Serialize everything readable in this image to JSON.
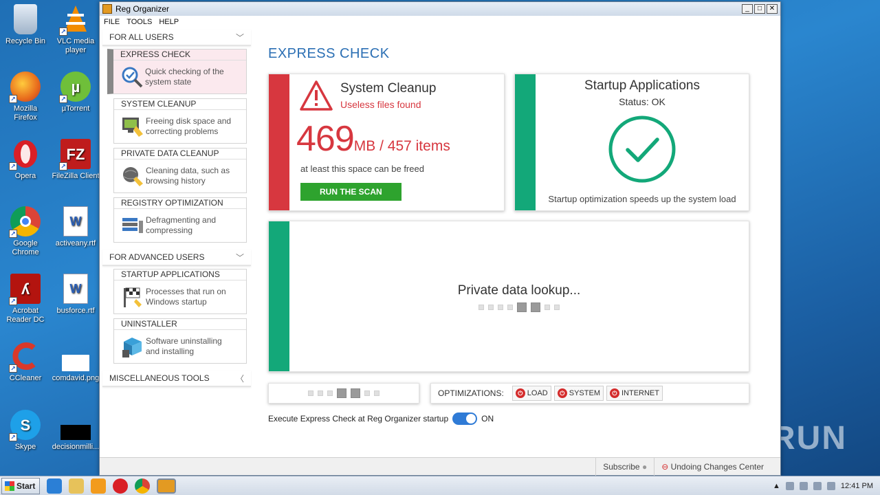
{
  "desktop": {
    "icons": [
      {
        "label": "Recycle Bin",
        "icon": "recycle-bin-icon",
        "color": "#c9d7e6"
      },
      {
        "label": "VLC media player",
        "icon": "vlc-icon",
        "color": "#f28c00"
      },
      {
        "label": "Mozilla Firefox",
        "icon": "firefox-icon",
        "color": "#e86b1c"
      },
      {
        "label": "µTorrent",
        "icon": "utorrent-icon",
        "color": "#6fbf3a"
      },
      {
        "label": "Opera",
        "icon": "opera-icon",
        "color": "#d91f26"
      },
      {
        "label": "FileZilla Client",
        "icon": "filezilla-icon",
        "color": "#bf1c1c"
      },
      {
        "label": "Google Chrome",
        "icon": "chrome-icon",
        "color": "#3f8bd7"
      },
      {
        "label": "activeany.rtf",
        "icon": "word-doc-icon",
        "color": "#ffffff"
      },
      {
        "label": "Acrobat Reader DC",
        "icon": "acrobat-icon",
        "color": "#b3140f"
      },
      {
        "label": "busforce.rtf",
        "icon": "word-doc-icon",
        "color": "#ffffff"
      },
      {
        "label": "CCleaner",
        "icon": "ccleaner-icon",
        "color": "#d9382a"
      },
      {
        "label": "comdavid.png",
        "icon": "image-file-icon",
        "color": "#ffffff"
      },
      {
        "label": "Skype",
        "icon": "skype-icon",
        "color": "#1ea0e8"
      },
      {
        "label": "decisionmilli...",
        "icon": "image-file-icon",
        "color": "#000000"
      }
    ],
    "watermark": "ANY RUN"
  },
  "window": {
    "title": "Reg Organizer",
    "menu": [
      "FILE",
      "TOOLS",
      "HELP"
    ],
    "controls": {
      "minimize": "_",
      "maximize": "□",
      "close": "✕"
    }
  },
  "sidebar": {
    "for_all_users": "FOR ALL USERS",
    "items_all": [
      {
        "title": "EXPRESS CHECK",
        "desc1": "Quick checking of the",
        "desc2": "system state",
        "icon": "magnifier-check-icon",
        "active": true
      },
      {
        "title": "SYSTEM CLEANUP",
        "desc1": "Freeing disk space and",
        "desc2": "correcting problems",
        "icon": "broom-screen-icon"
      },
      {
        "title": "PRIVATE DATA CLEANUP",
        "desc1": "Cleaning data, such as",
        "desc2": "browsing history",
        "icon": "globe-brush-icon"
      },
      {
        "title": "REGISTRY OPTIMIZATION",
        "desc1": "Defragmenting and",
        "desc2": "compressing",
        "icon": "registry-blocks-icon"
      }
    ],
    "for_advanced_users": "FOR ADVANCED USERS",
    "items_adv": [
      {
        "title": "STARTUP APPLICATIONS",
        "desc1": "Processes that run on",
        "desc2": "Windows startup",
        "icon": "flag-startup-icon"
      },
      {
        "title": "UNINSTALLER",
        "desc1": "Software uninstalling",
        "desc2": "and installing",
        "icon": "box-trash-icon"
      }
    ],
    "misc_tools": "MISCELLANEOUS TOOLS"
  },
  "main": {
    "title": "EXPRESS CHECK",
    "cleanup": {
      "title": "System Cleanup",
      "subtitle": "Useless files found",
      "size_number": "469",
      "size_rest": "MB / 457 items",
      "note": "at least this space can be freed",
      "button": "RUN THE SCAN",
      "accent": "#d7373f"
    },
    "startup": {
      "title": "Startup Applications",
      "status": "Status: OK",
      "note": "Startup optimization speeds up the system load",
      "accent": "#13a879"
    },
    "private": {
      "text": "Private data lookup..."
    },
    "optimizations": {
      "label": "OPTIMIZATIONS:",
      "buttons": [
        "LOAD",
        "SYSTEM",
        "INTERNET"
      ]
    },
    "startup_toggle": {
      "label": "Execute Express Check at Reg Organizer startup",
      "state": "ON"
    }
  },
  "statusbar": {
    "subscribe": "Subscribe",
    "undo": "Undoing Changes Center"
  },
  "taskbar": {
    "start": "Start",
    "clock": "12:41 PM"
  }
}
